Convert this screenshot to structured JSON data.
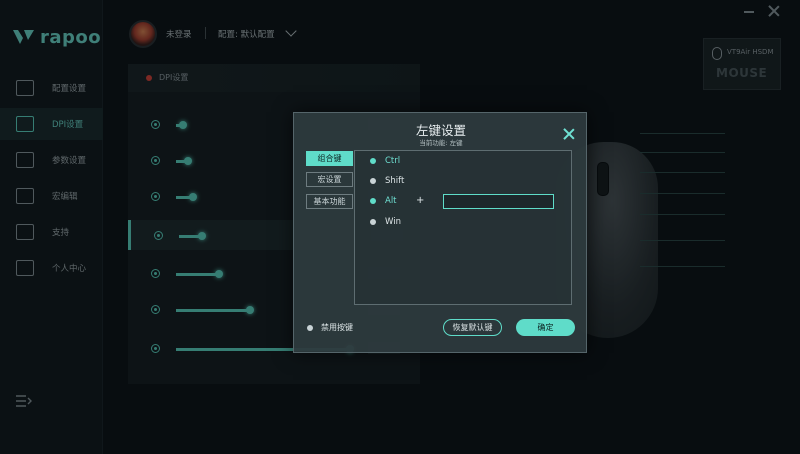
{
  "app": {
    "brand": "rapoo",
    "accent_color": "#5fdcc9"
  },
  "sidebar": {
    "items": [
      {
        "label": "配置设置",
        "icon": "config-icon",
        "active": false
      },
      {
        "label": "DPI设置",
        "icon": "dpi-icon",
        "active": true
      },
      {
        "label": "参数设置",
        "icon": "sliders-icon",
        "active": false
      },
      {
        "label": "宏编辑",
        "icon": "macro-icon",
        "active": false
      },
      {
        "label": "支持",
        "icon": "thumbs-up-icon",
        "active": false
      },
      {
        "label": "个人中心",
        "icon": "user-icon",
        "active": false
      }
    ],
    "collapse_icon": "menu-collapse-icon"
  },
  "topbar": {
    "login_status": "未登录",
    "config_label": "配置: 默认配置"
  },
  "dpi_panel": {
    "title": "DPI设置",
    "levels": [
      {
        "fill": 0.03,
        "selected": false
      },
      {
        "fill": 0.06,
        "selected": false
      },
      {
        "fill": 0.09,
        "selected": false
      },
      {
        "fill": 0.12,
        "selected": true
      },
      {
        "fill": 0.24,
        "selected": false
      },
      {
        "fill": 0.42,
        "selected": false
      },
      {
        "fill": 1.0,
        "selected": false
      }
    ]
  },
  "device": {
    "model": "VT9Air HSDM",
    "type_label": "MOUSE"
  },
  "modal": {
    "title": "左键设置",
    "subtitle": "当前功能: 左键",
    "tabs": [
      {
        "label": "组合键",
        "active": true
      },
      {
        "label": "宏设置",
        "active": false
      },
      {
        "label": "基本功能",
        "active": false
      }
    ],
    "modifiers": [
      {
        "label": "Ctrl",
        "selected": true
      },
      {
        "label": "Shift",
        "selected": false
      },
      {
        "label": "Alt",
        "selected": true
      },
      {
        "label": "Win",
        "selected": false
      }
    ],
    "plus": "+",
    "key_input_value": "",
    "disable_label": "禁用按键",
    "restore_button": "恢复默认键",
    "ok_button": "确定"
  }
}
